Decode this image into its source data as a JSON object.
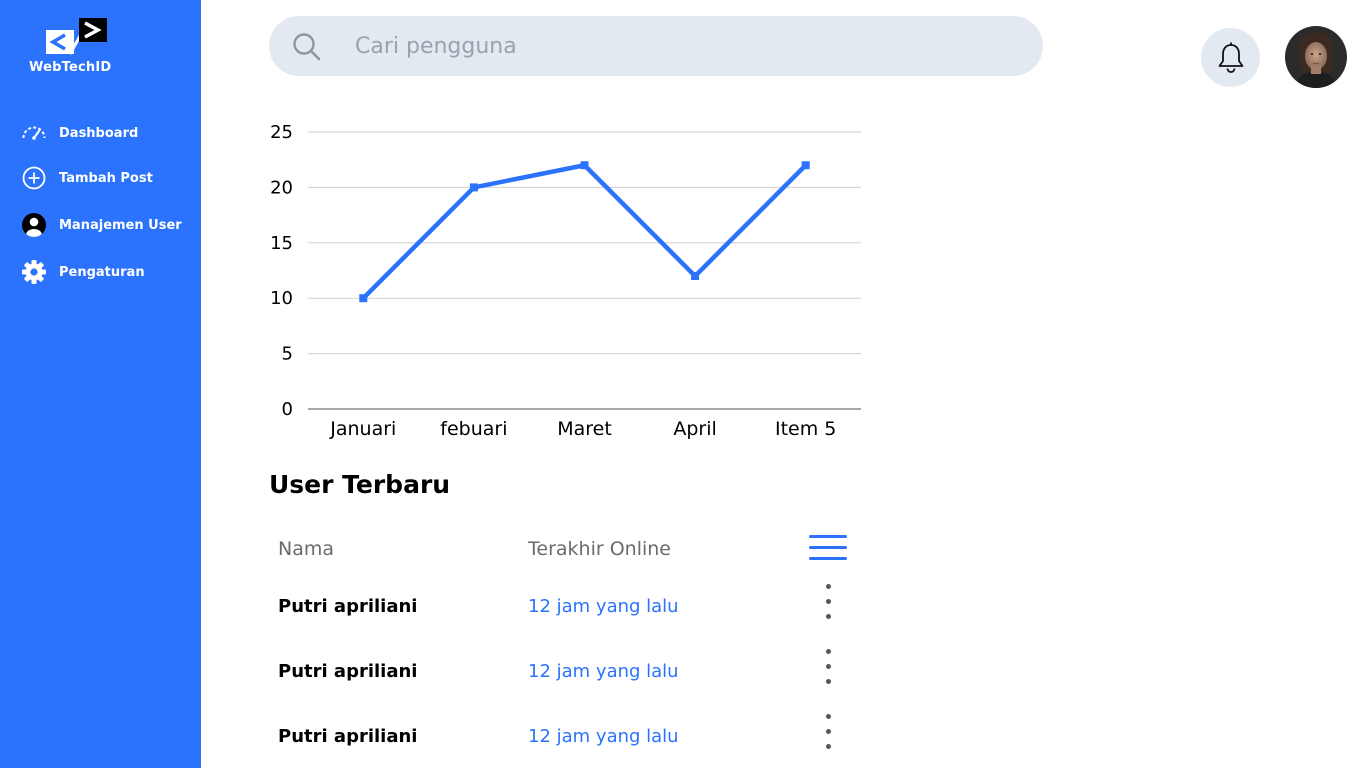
{
  "brand": {
    "name": "WebTechID",
    "color": "#2b73fc"
  },
  "sidebar": {
    "items": [
      {
        "label": "Dashboard",
        "icon": "speedometer-icon"
      },
      {
        "label": "Tambah Post",
        "icon": "plus-circle-icon"
      },
      {
        "label": "Manajemen User",
        "icon": "user-circle-icon"
      },
      {
        "label": "Pengaturan",
        "icon": "gear-icon"
      }
    ]
  },
  "header": {
    "search_placeholder": "Cari pengguna",
    "search_value": "",
    "notification_icon": "bell-icon",
    "avatar_icon": "user-avatar"
  },
  "chart_data": {
    "type": "line",
    "categories": [
      "Januari",
      "febuari",
      "Maret",
      "April",
      "Item 5"
    ],
    "series": [
      {
        "values": [
          10,
          20,
          22,
          12,
          22
        ],
        "color": "#2b73fc"
      }
    ],
    "ylim": [
      0,
      25
    ],
    "yticks": [
      "0",
      "5",
      "10",
      "15",
      "20",
      "25"
    ],
    "grid": true,
    "title": "",
    "xlabel": "",
    "ylabel": ""
  },
  "users": {
    "title": "User Terbaru",
    "columns": [
      "Nama",
      "Terakhir Online"
    ],
    "rows": [
      {
        "name": "Putri apriliani",
        "last_online": "12 jam yang lalu"
      },
      {
        "name": "Putri apriliani",
        "last_online": "12 jam yang lalu"
      },
      {
        "name": "Putri apriliani",
        "last_online": "12 jam yang lalu"
      }
    ]
  }
}
